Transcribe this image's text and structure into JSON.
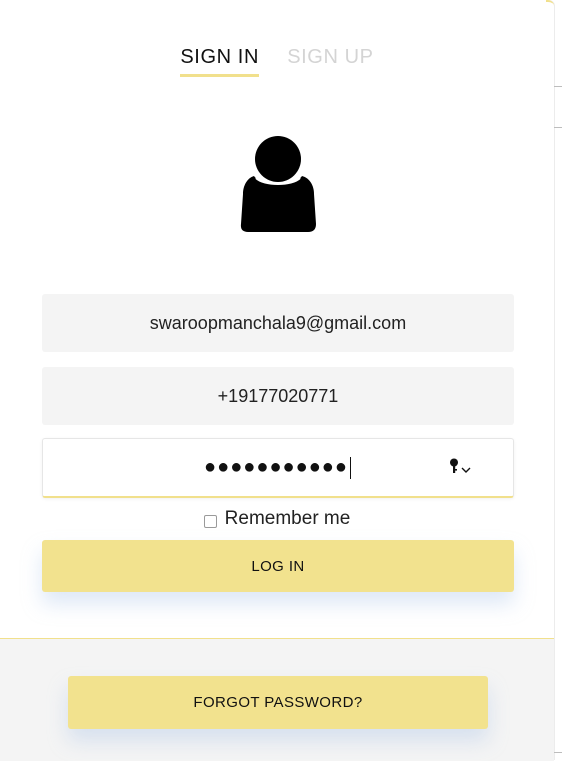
{
  "tabs": {
    "sign_in": "SIGN IN",
    "sign_up": "SIGN UP"
  },
  "avatar": {
    "icon": "user-silhouette-icon"
  },
  "form": {
    "email_value": "swaroopmanchala9@gmail.com",
    "phone_value": "+19177020771",
    "password_masked": "●●●●●●●●●●●",
    "password_tool_icon": "key-icon",
    "remember_label": "Remember me",
    "remember_checked": false,
    "login_label": "LOG IN"
  },
  "footer": {
    "forgot_label": "FORGOT PASSWORD?"
  },
  "colors": {
    "accent": "#f2e28e",
    "accent_line": "#f1e08c",
    "field_bg": "#f4f4f4",
    "inactive_tab": "#d4d4d4"
  }
}
